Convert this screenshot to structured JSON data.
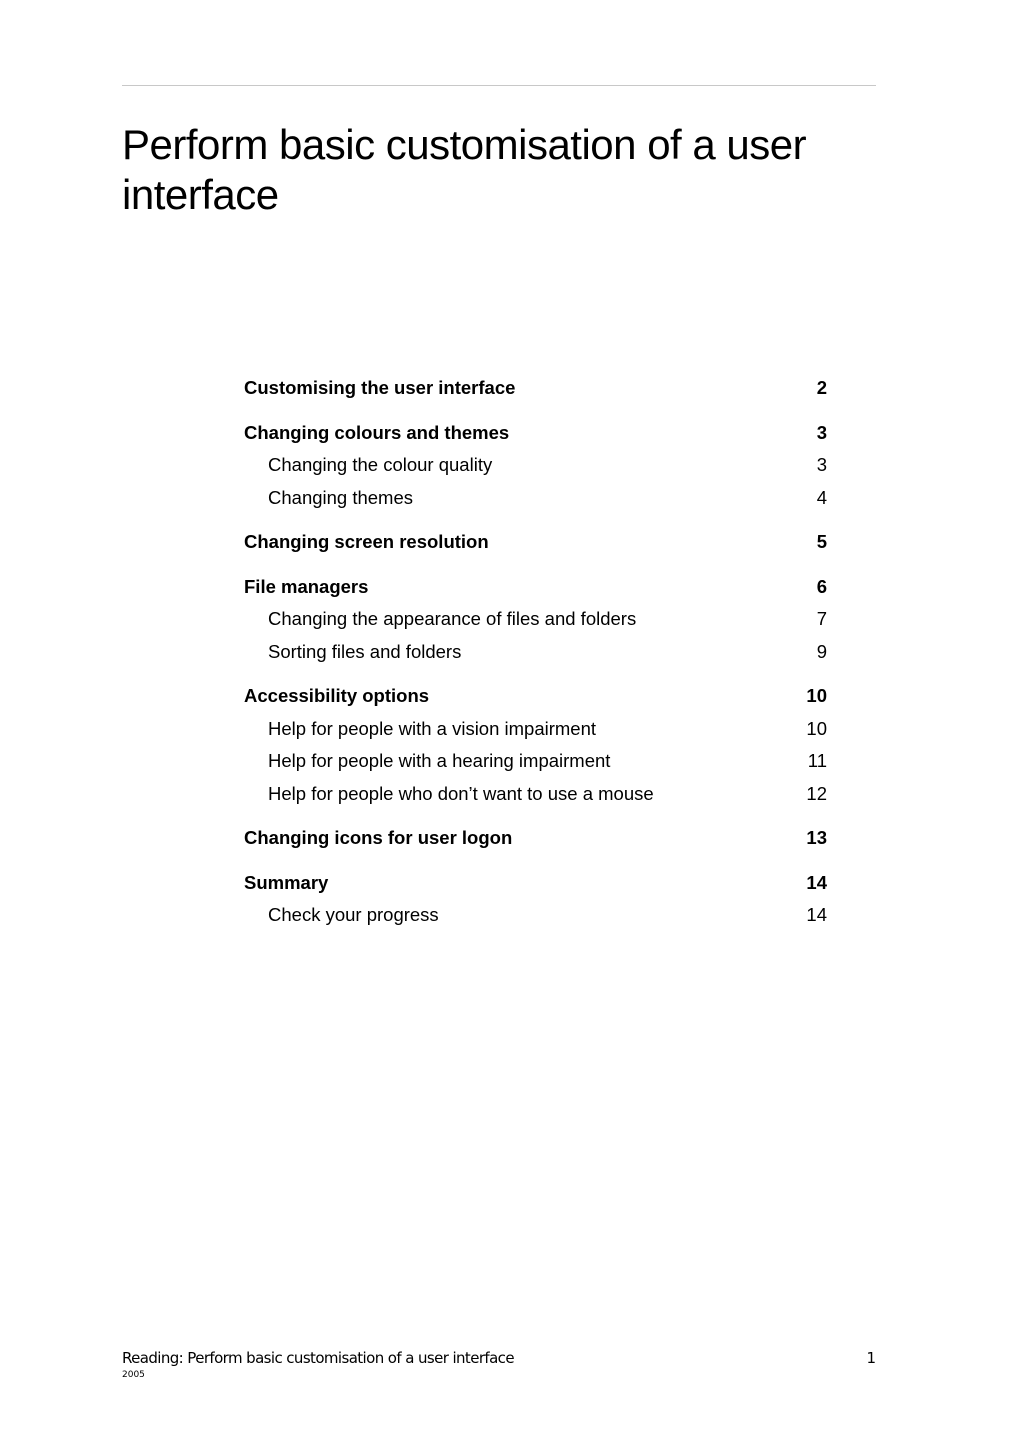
{
  "header": {
    "title": "Perform basic customisation of a user interface"
  },
  "toc": {
    "entries": [
      {
        "level": 1,
        "label": "Customising the user interface",
        "page": "2"
      },
      {
        "level": 1,
        "label": "Changing colours and themes",
        "page": "3"
      },
      {
        "level": 2,
        "label": "Changing the colour quality",
        "page": "3"
      },
      {
        "level": 2,
        "label": "Changing themes",
        "page": "4"
      },
      {
        "level": 1,
        "label": "Changing screen resolution",
        "page": "5"
      },
      {
        "level": 1,
        "label": "File managers",
        "page": "6"
      },
      {
        "level": 2,
        "label": "Changing the appearance of files and folders",
        "page": "7"
      },
      {
        "level": 2,
        "label": "Sorting files and folders",
        "page": "9"
      },
      {
        "level": 1,
        "label": "Accessibility options",
        "page": "10"
      },
      {
        "level": 2,
        "label": "Help for people with a vision impairment",
        "page": "10"
      },
      {
        "level": 2,
        "label": "Help for people with a hearing impairment",
        "page": "11"
      },
      {
        "level": 2,
        "label": "Help for people who don’t want to use a mouse",
        "page": "12"
      },
      {
        "level": 1,
        "label": "Changing icons for user logon",
        "page": "13"
      },
      {
        "level": 1,
        "label": "Summary",
        "page": "14"
      },
      {
        "level": 2,
        "label": "Check your progress",
        "page": "14"
      }
    ]
  },
  "footer": {
    "title": "Reading: Perform basic customisation of a user interface",
    "page_number": "1",
    "year": "2005"
  }
}
